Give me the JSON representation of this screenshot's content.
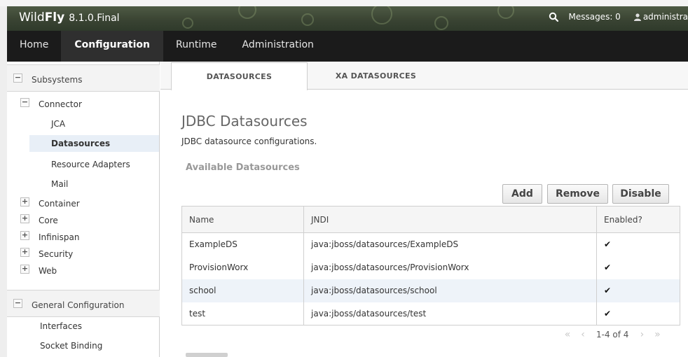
{
  "header": {
    "brand_wild": "Wild",
    "brand_fly": "Fly",
    "version": "8.1.0.Final",
    "messages": "Messages: 0",
    "user": "administra"
  },
  "nav": {
    "tabs": [
      {
        "label": "Home"
      },
      {
        "label": "Configuration",
        "active": true
      },
      {
        "label": "Runtime"
      },
      {
        "label": "Administration"
      }
    ]
  },
  "sidebar": {
    "subsystems": {
      "label": "Subsystems",
      "connector": {
        "label": "Connector",
        "items": [
          "JCA",
          "Datasources",
          "Resource Adapters",
          "Mail"
        ],
        "active": "Datasources"
      },
      "collapsed": [
        "Container",
        "Core",
        "Infinispan",
        "Security",
        "Web"
      ]
    },
    "general": {
      "label": "General Configuration",
      "items": [
        "Interfaces",
        "Socket Binding"
      ]
    }
  },
  "main": {
    "subtabs": [
      {
        "label": "DATASOURCES",
        "active": true
      },
      {
        "label": "XA DATASOURCES"
      }
    ],
    "title": "JDBC Datasources",
    "description": "JDBC datasource configurations.",
    "available_label": "Available Datasources",
    "buttons": {
      "add": "Add",
      "remove": "Remove",
      "disable": "Disable"
    },
    "table": {
      "columns": [
        "Name",
        "JNDI",
        "Enabled?"
      ],
      "rows": [
        {
          "name": "ExampleDS",
          "jndi": "java:jboss/datasources/ExampleDS",
          "enabled": "✔"
        },
        {
          "name": "ProvisionWorx",
          "jndi": "java:jboss/datasources/ProvisionWorx",
          "enabled": "✔"
        },
        {
          "name": "school",
          "jndi": "java:jboss/datasources/school",
          "enabled": "✔"
        },
        {
          "name": "test",
          "jndi": "java:jboss/datasources/test",
          "enabled": "✔"
        }
      ],
      "selected_row": 2
    },
    "pager": {
      "range": "1-4 of 4"
    }
  },
  "colors": {
    "header_bg": "#3a4433",
    "nav_bg": "#1b1b1b",
    "nav_active_bg": "#2f2f2f",
    "selected_item_bg": "#e8eff7"
  }
}
